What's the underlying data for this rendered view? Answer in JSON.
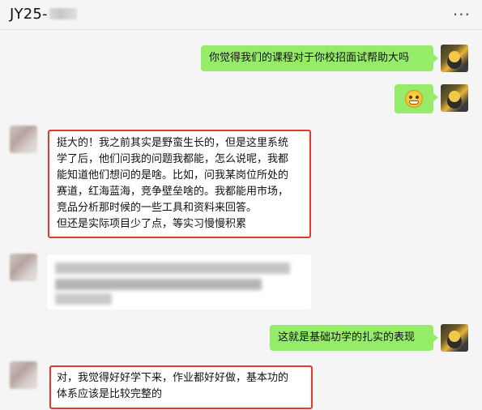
{
  "header": {
    "title": "JY25-",
    "more_icon": "more-dots-icon"
  },
  "messages": [
    {
      "side": "right",
      "type": "text",
      "text": "你觉得我们的课程对于你校招面试帮助大吗"
    },
    {
      "side": "right",
      "type": "emoji",
      "emoji": "grinning-face-icon"
    },
    {
      "side": "left",
      "type": "text",
      "highlighted": true,
      "lines": [
        "挺大的！我之前其实是野蛮生长的，但是这里系统",
        "学了后，他们问我的问题我都能，怎么说呢，我都",
        "能知道他们想问的是啥。比如，问我某岗位所处的",
        "赛道，红海蓝海，竞争壁垒啥的。我都能用市场，",
        "竞品分析那时候的一些工具和资料来回答。",
        "但还是实际项目少了点，等实习慢慢积累"
      ]
    },
    {
      "side": "left",
      "type": "blurred-text"
    },
    {
      "side": "right",
      "type": "text",
      "text": "这就是基础功学的扎实的表现"
    },
    {
      "side": "left",
      "type": "text",
      "highlighted": true,
      "lines": [
        "对，我觉得好好学下来，作业都好好做，基本功的",
        "体系应该是比较完整的"
      ]
    }
  ],
  "colors": {
    "background": "#f5f5f5",
    "bubble_mine": "#95ec69",
    "bubble_other": "#ffffff",
    "highlight_border": "#e23a2e"
  }
}
